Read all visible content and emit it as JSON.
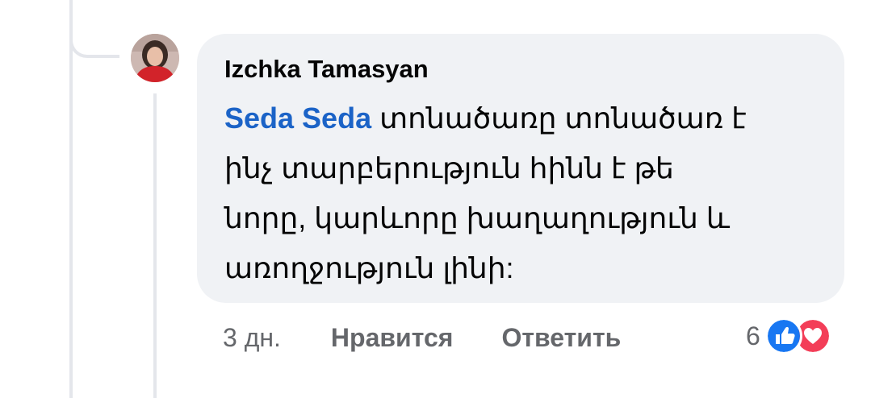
{
  "comment": {
    "author": "Izchka Tamasyan",
    "mention": "Seda Seda",
    "text_lines": [
      " տոնածառը տոնածառ է",
      "ինչ տարբերություն հինն է թե",
      "նորը, կարևորը խաղաղություն և",
      "առողջություն լինի:"
    ]
  },
  "actions": {
    "time": "3 дн.",
    "like_label": "Нравится",
    "reply_label": "Ответить"
  },
  "reactions": {
    "count": "6",
    "icons": [
      "like-icon",
      "love-icon"
    ],
    "like_color": "#1877f2",
    "love_color": "#f33e58"
  }
}
